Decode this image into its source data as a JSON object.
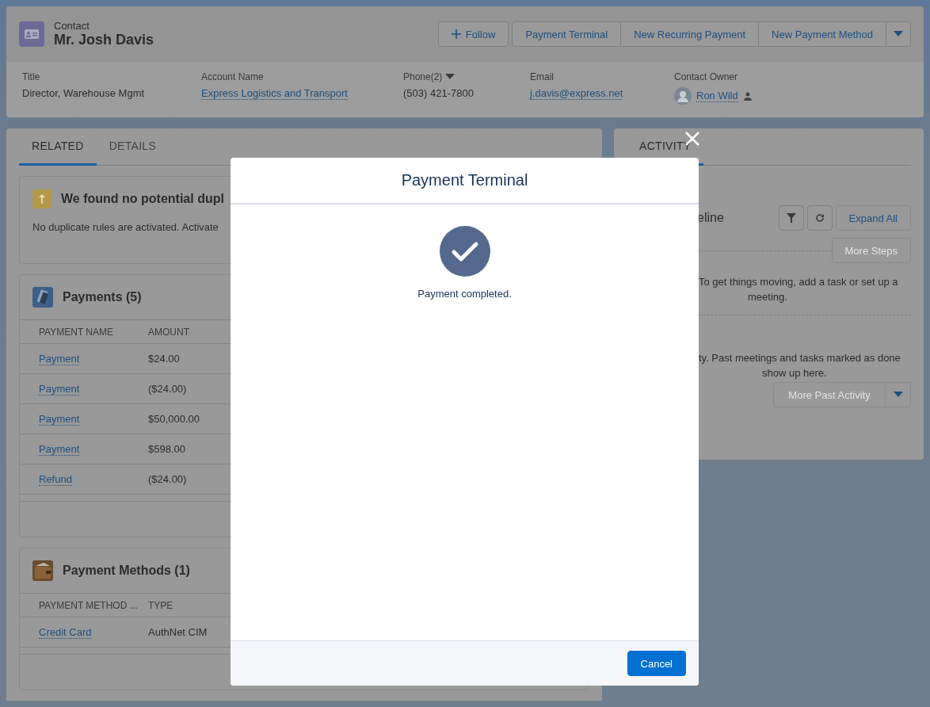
{
  "record": {
    "object_type": "Contact",
    "name": "Mr. Josh Davis",
    "actions": [
      {
        "label": "Follow",
        "kind": "follow"
      },
      {
        "label": "Payment Terminal",
        "kind": "action"
      },
      {
        "label": "New Recurring Payment",
        "kind": "action"
      },
      {
        "label": "New Payment Method",
        "kind": "action"
      },
      {
        "kind": "menu"
      }
    ],
    "fields": [
      {
        "label": "Title",
        "value": "Director, Warehouse Mgmt",
        "kind": "text",
        "menu": false
      },
      {
        "label": "Account Name",
        "value": "Express Logistics and Transport",
        "kind": "link",
        "menu": false
      },
      {
        "label": "Phone(2)",
        "value": "(503) 421-7800",
        "kind": "text",
        "menu": true
      },
      {
        "label": "Email",
        "value": "j.davis@express.net",
        "kind": "link",
        "menu": false
      },
      {
        "label": "Contact Owner",
        "value": "Ron Wild",
        "kind": "owner",
        "menu": false
      }
    ]
  },
  "tabs": [
    {
      "label": "RELATED",
      "selected": true
    },
    {
      "label": "DETAILS",
      "selected": false
    }
  ],
  "duplicates": {
    "title": "We found no potential dupl",
    "message": "No duplicate rules are activated. Activate"
  },
  "related_lists": [
    {
      "title": "Payments (5)",
      "kind": "payments",
      "columns": [
        "PAYMENT NAME",
        "AMOUNT"
      ],
      "rows": [
        {
          "name": "Payment",
          "value": "$24.00"
        },
        {
          "name": "Payment",
          "value": "($24.00)"
        },
        {
          "name": "Payment",
          "value": "$50,000.00"
        },
        {
          "name": "Payment",
          "value": "$598.00"
        },
        {
          "name": "Refund",
          "value": "($24.00)"
        }
      ]
    },
    {
      "title": "Payment Methods (1)",
      "kind": "wallet",
      "columns": [
        "PAYMENT METHOD ...",
        "TYPE"
      ],
      "rows": [
        {
          "name": "Credit Card",
          "value": "AuthNet CIM"
        }
      ]
    }
  ],
  "activity": {
    "tabs": [
      {
        "label": "ACTIVITY",
        "selected": true
      }
    ],
    "timeline_title": "eline",
    "expand_button": "Expand All",
    "more_steps": {
      "label": "More Steps",
      "disabled": true
    },
    "upcoming_message": [
      "To get things moving, add a task or set up a",
      "meeting."
    ],
    "past_message": [
      "ty. Past meetings and tasks marked as done",
      "show up here."
    ],
    "more_past": {
      "label": "More Past Activity",
      "disabled": true
    }
  },
  "modal": {
    "title": "Payment Terminal",
    "message": "Payment completed.",
    "buttons": [
      "Cancel"
    ]
  }
}
